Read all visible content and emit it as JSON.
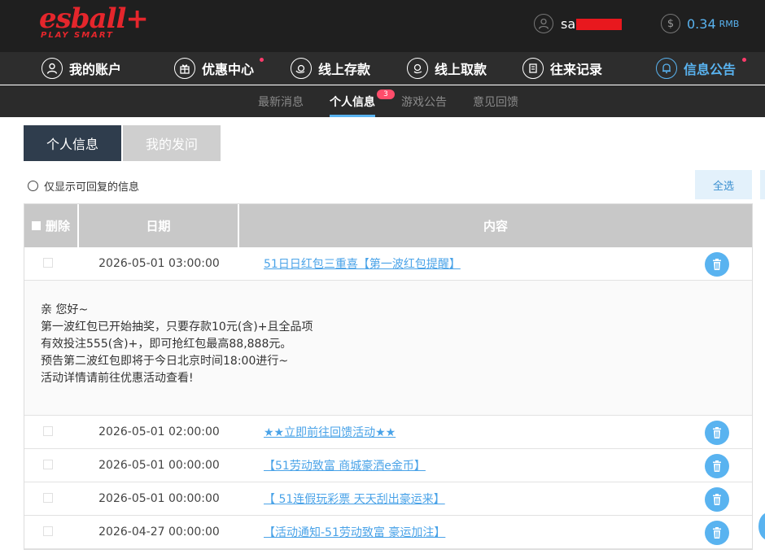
{
  "header": {
    "logo_main": "esball+",
    "logo_sub": "PLAY SMART",
    "username": "sa",
    "balance": "0.34",
    "currency": "RMB"
  },
  "nav": {
    "items": [
      {
        "label": "我的账户",
        "icon": "user-icon",
        "dot": false
      },
      {
        "label": "优惠中心",
        "icon": "gift-icon",
        "dot": true
      },
      {
        "label": "线上存款",
        "icon": "deposit-icon",
        "dot": false
      },
      {
        "label": "线上取款",
        "icon": "withdraw-icon",
        "dot": false
      },
      {
        "label": "往来记录",
        "icon": "records-icon",
        "dot": false
      },
      {
        "label": "信息公告",
        "icon": "bell-icon",
        "dot": true,
        "active": true
      }
    ]
  },
  "subnav": {
    "items": [
      "最新消息",
      "个人信息",
      "游戏公告",
      "意见回馈"
    ],
    "active": "个人信息",
    "badge": "3"
  },
  "tabs": {
    "active": "个人信息",
    "inactive": "我的发问"
  },
  "filter": {
    "label": "仅显示可回复的信息"
  },
  "select_all": "全选",
  "table": {
    "headers": {
      "delete": "删除",
      "date": "日期",
      "content": "内容"
    },
    "rows": [
      {
        "date": "2026-05-01 03:00:00",
        "title": "51日日红包三重喜【第一波红包提醒】",
        "expanded": true
      },
      {
        "date": "2026-05-01 02:00:00",
        "title": "★★立即前往回馈活动★★"
      },
      {
        "date": "2026-05-01 00:00:00",
        "title": "【51劳动致富 商城豪洒e金币】"
      },
      {
        "date": "2026-05-01 00:00:00",
        "title": "【 51连假玩彩票 天天刮出豪运来】"
      },
      {
        "date": "2026-04-27 00:00:00",
        "title": "【活动通知-51劳动致富 豪运加注】"
      }
    ],
    "detail_lines": [
      "亲 您好~",
      "第一波红包已开始抽奖，只要存款10元(含)+且全品项",
      "有效投注555(含)+，即可抢红包最高88,888元。",
      "预告第二波红包即将于今日北京时间18:00进行~",
      "活动详情请前往优惠活动查看!"
    ]
  },
  "colors": {
    "accent": "#59b3f0",
    "logo_red": "#e5262c",
    "topbar": "#1f1f1f",
    "nav_bg": "#2d2d2d",
    "tab_active": "#2f3d4d",
    "header_gray": "#c8c8c8"
  }
}
